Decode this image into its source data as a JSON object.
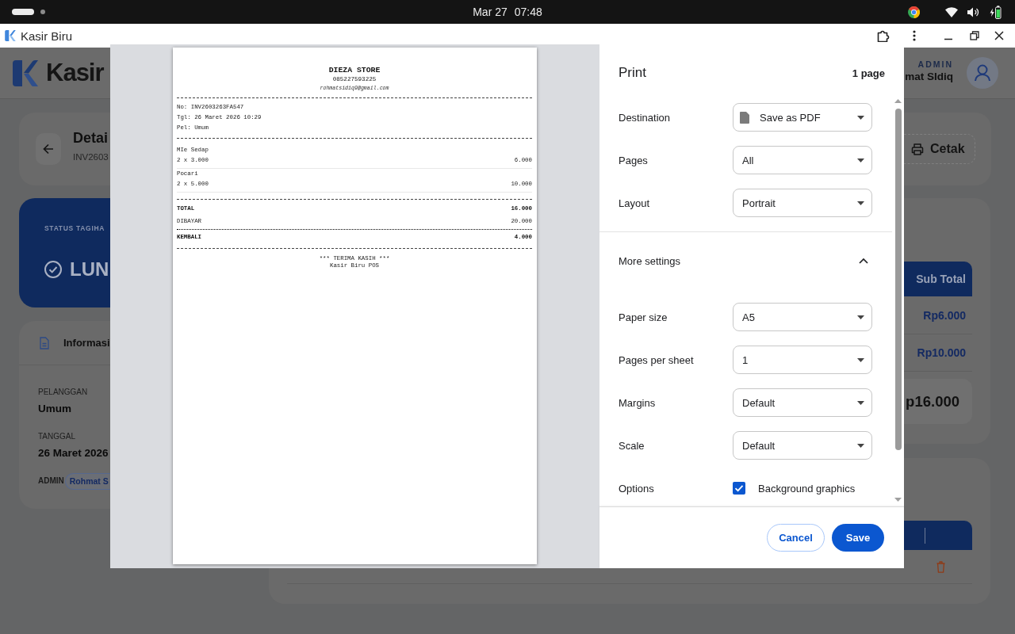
{
  "system_bar": {
    "date": "Mar 27",
    "time": "07:48"
  },
  "window": {
    "title": "Kasir Biru"
  },
  "app": {
    "header": {
      "brand": "Kasir",
      "role": "ADMIN",
      "user_name": "mat SIdiq"
    },
    "page_header": {
      "title": "Detai",
      "subtitle": "INV2603",
      "print_button": "Cetak"
    },
    "status_card": {
      "label": "STATUS TAGIHA",
      "status": "LUN"
    },
    "info_card": {
      "title": "Informasi",
      "fields": [
        {
          "label": "PELANGGAN",
          "value": "Umum"
        },
        {
          "label": "TANGGAL",
          "value": "26 Maret 2026"
        }
      ],
      "admin": {
        "label": "ADMIN",
        "value": "Rohmat S"
      }
    },
    "items_table": {
      "columns": [
        "Sub Total"
      ],
      "rows": [
        [
          "Rp6.000"
        ],
        [
          "Rp10.000"
        ]
      ],
      "total": "p16.000"
    }
  },
  "print_dialog": {
    "receipt": {
      "store": "DIEZA STORE",
      "phone": "085227593225",
      "email": "rohmatsidiq9@gmail.com",
      "meta": [
        "No: INV2603263FA547",
        "Tgl: 26 Maret 2026 10:29",
        "Pel: Umum"
      ],
      "items": [
        {
          "name": "MIe Sedap",
          "qty_price": "2 x 3.000",
          "amount": "6.000"
        },
        {
          "name": "Pocari",
          "qty_price": "2 x 5.000",
          "amount": "10.000"
        }
      ],
      "totals": [
        {
          "label": "TOTAL",
          "value": "16.000",
          "strong": true
        },
        {
          "label": "DIBAYAR",
          "value": "20.000",
          "strong": false
        }
      ],
      "change": {
        "label": "KEMBALI",
        "value": "4.000"
      },
      "footer": [
        "*** TERIMA KASIH ***",
        "Kasir Biru POS"
      ]
    },
    "title": "Print",
    "page_count": "1 page",
    "settings": [
      {
        "kind": "destination",
        "label": "Destination",
        "value": "Save as PDF"
      },
      {
        "kind": "select",
        "label": "Pages",
        "value": "All"
      },
      {
        "kind": "select",
        "label": "Layout",
        "value": "Portrait"
      }
    ],
    "more_settings": {
      "label": "More settings",
      "expanded": true,
      "settings": [
        {
          "kind": "select",
          "label": "Paper size",
          "value": "A5"
        },
        {
          "kind": "select",
          "label": "Pages per sheet",
          "value": "1"
        },
        {
          "kind": "select",
          "label": "Margins",
          "value": "Default"
        },
        {
          "kind": "select",
          "label": "Scale",
          "value": "Default"
        },
        {
          "kind": "checkbox",
          "label": "Options",
          "text": "Background graphics",
          "checked": true
        }
      ]
    },
    "buttons": [
      {
        "kind": "cancel",
        "label": "Cancel"
      },
      {
        "kind": "save",
        "label": "Save"
      }
    ]
  }
}
